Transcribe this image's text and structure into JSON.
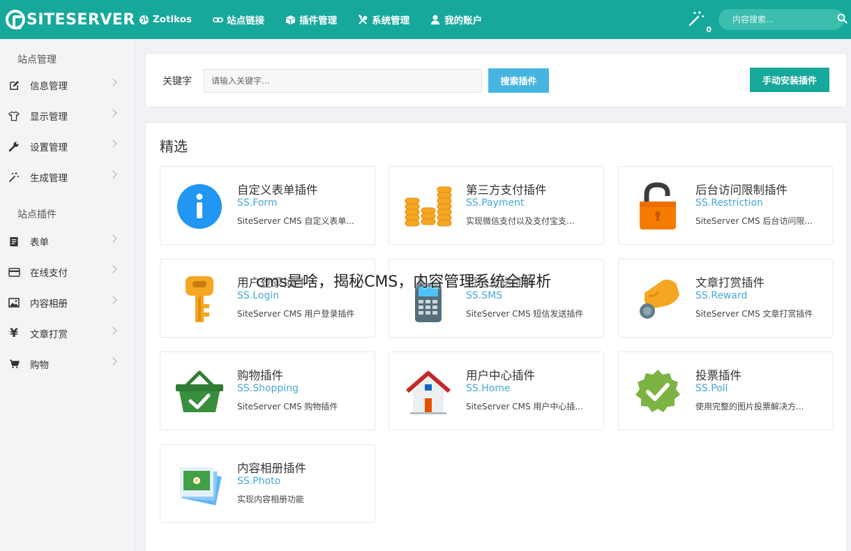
{
  "header": {
    "logo_text": "SITESERVER",
    "nav": [
      {
        "label": "Zotikos",
        "icon": "globe-icon"
      },
      {
        "label": "站点链接",
        "icon": "link-icon"
      },
      {
        "label": "插件管理",
        "icon": "cube-icon"
      },
      {
        "label": "系统管理",
        "icon": "tools-icon"
      },
      {
        "label": "我的账户",
        "icon": "user-icon"
      }
    ],
    "notification_count": "0",
    "search_placeholder": "内容搜索..."
  },
  "sidebar": {
    "section1_title": "站点管理",
    "section1_items": [
      {
        "label": "信息管理",
        "icon": "edit-icon"
      },
      {
        "label": "显示管理",
        "icon": "shirt-icon"
      },
      {
        "label": "设置管理",
        "icon": "wrench-icon"
      },
      {
        "label": "生成管理",
        "icon": "magic-wand-icon"
      }
    ],
    "section2_title": "站点插件",
    "section2_items": [
      {
        "label": "表单",
        "icon": "form-icon"
      },
      {
        "label": "在线支付",
        "icon": "credit-card-icon"
      },
      {
        "label": "内容相册",
        "icon": "picture-icon"
      },
      {
        "label": "文章打赏",
        "icon": "yen-icon"
      },
      {
        "label": "购物",
        "icon": "cart-icon"
      }
    ]
  },
  "search_panel": {
    "keyword_label": "关键字",
    "keyword_placeholder": "请输入关键字...",
    "search_button": "搜索插件",
    "install_button": "手动安装插件"
  },
  "featured": {
    "title": "精选",
    "plugins": [
      {
        "name": "自定义表单插件",
        "id": "SS.Form",
        "desc": "SiteServer CMS 自定义表单...",
        "icon": "info-icon"
      },
      {
        "name": "第三方支付插件",
        "id": "SS.Payment",
        "desc": "实现微信支付以及支付宝支...",
        "icon": "coins-icon"
      },
      {
        "name": "后台访问限制插件",
        "id": "SS.Restriction",
        "desc": "SiteServer CMS 后台访问限...",
        "icon": "padlock-icon"
      },
      {
        "name": "用户登录插件",
        "id": "SS.Login",
        "desc": "SiteServer CMS 用户登录插件",
        "icon": "key-icon"
      },
      {
        "name": "短信发送插件",
        "id": "SS.SMS",
        "desc": "SiteServer CMS 短信发送插件",
        "icon": "phone-icon"
      },
      {
        "name": "文章打赏插件",
        "id": "SS.Reward",
        "desc": "SiteServer CMS 文章打赏插件",
        "icon": "hand-coin-icon"
      },
      {
        "name": "购物插件",
        "id": "SS.Shopping",
        "desc": "SiteServer CMS 购物插件",
        "icon": "basket-icon"
      },
      {
        "name": "用户中心插件",
        "id": "SS.Home",
        "desc": "SiteServer CMS 用户中心插...",
        "icon": "house-icon"
      },
      {
        "name": "投票插件",
        "id": "SS.Poll",
        "desc": "使用完整的图片投票解决方...",
        "icon": "check-badge-icon"
      },
      {
        "name": "内容相册插件",
        "id": "SS.Photo",
        "desc": "实现内容相册功能",
        "icon": "photos-icon"
      }
    ]
  },
  "overlay_text": "cms是啥，揭秘CMS，内容管理系统全解析"
}
